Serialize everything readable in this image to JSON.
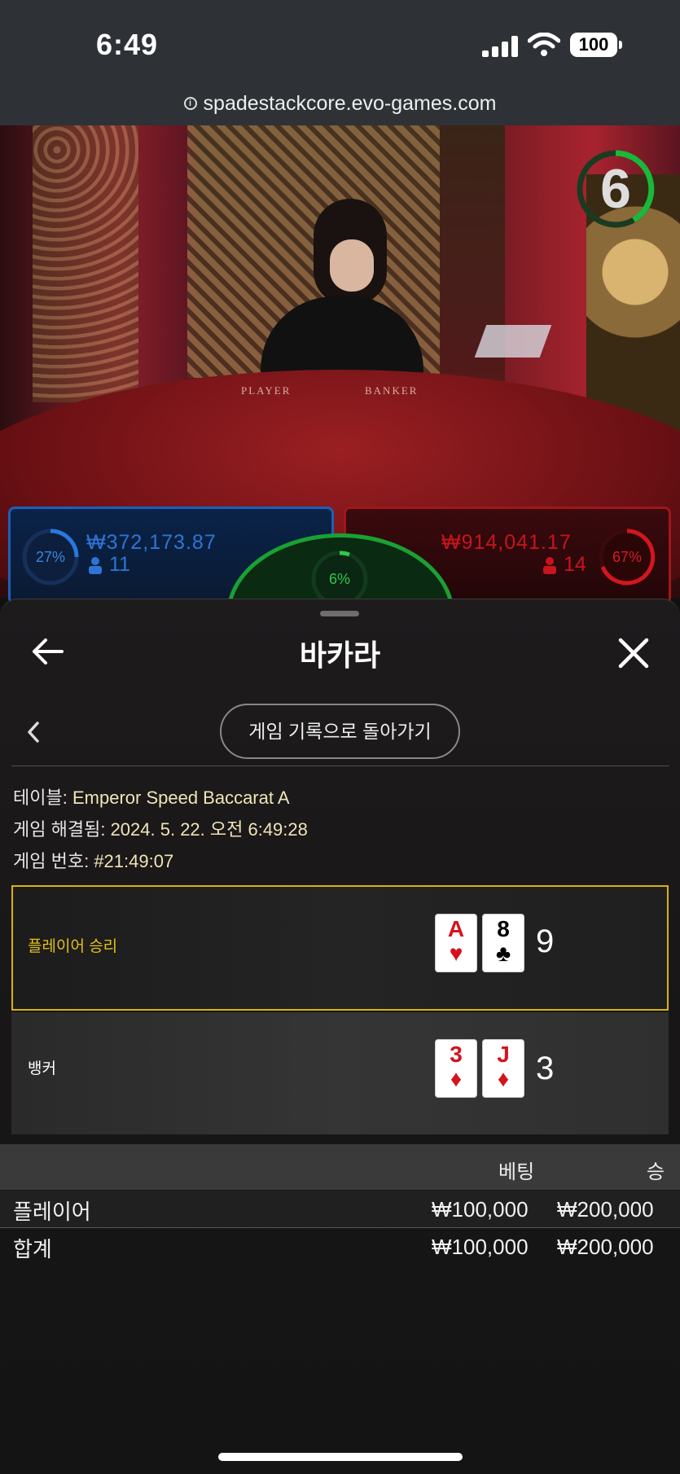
{
  "status_bar": {
    "time": "6:49",
    "battery": "100"
  },
  "browser": {
    "url": "spadestackcore.evo-games.com"
  },
  "stream": {
    "timer": "6",
    "table_labels": [
      "PLAYER",
      "BANKER"
    ],
    "player_bet": {
      "percent": "27%",
      "amount": "₩372,173.87",
      "count": "11"
    },
    "banker_bet": {
      "percent": "67%",
      "amount": "₩914,041.17",
      "count": "14"
    },
    "tie_bet": {
      "percent": "6%"
    }
  },
  "sheet": {
    "title": "바카라",
    "history_button": "게임 기록으로 돌아가기",
    "info": {
      "table_label": "테이블:",
      "table_value": "Emperor Speed Baccarat A",
      "resolved_label": "게임 해결됨:",
      "resolved_value": "2024. 5. 22. 오전 6:49:28",
      "game_no_label": "게임 번호:",
      "game_no_value": "#21:49:07"
    },
    "player_row": {
      "label": "플레이어 승리",
      "cards": [
        {
          "rank": "A",
          "suit": "♥",
          "color": "red"
        },
        {
          "rank": "8",
          "suit": "♣",
          "color": "black"
        }
      ],
      "score": "9"
    },
    "banker_row": {
      "label": "뱅커",
      "cards": [
        {
          "rank": "3",
          "suit": "♦",
          "color": "red"
        },
        {
          "rank": "J",
          "suit": "♦",
          "color": "red"
        }
      ],
      "score": "3"
    },
    "bets_table": {
      "headers": {
        "bet": "베팅",
        "win": "승"
      },
      "rows": [
        {
          "label": "플레이어",
          "bet": "₩100,000",
          "win": "₩200,000"
        },
        {
          "label": "합계",
          "bet": "₩100,000",
          "win": "₩200,000"
        }
      ]
    }
  },
  "colors": {
    "highlight": "#d8b310",
    "player_blue": "#1e5fb8",
    "banker_red": "#a0161c",
    "tie_green": "#1aa033"
  }
}
